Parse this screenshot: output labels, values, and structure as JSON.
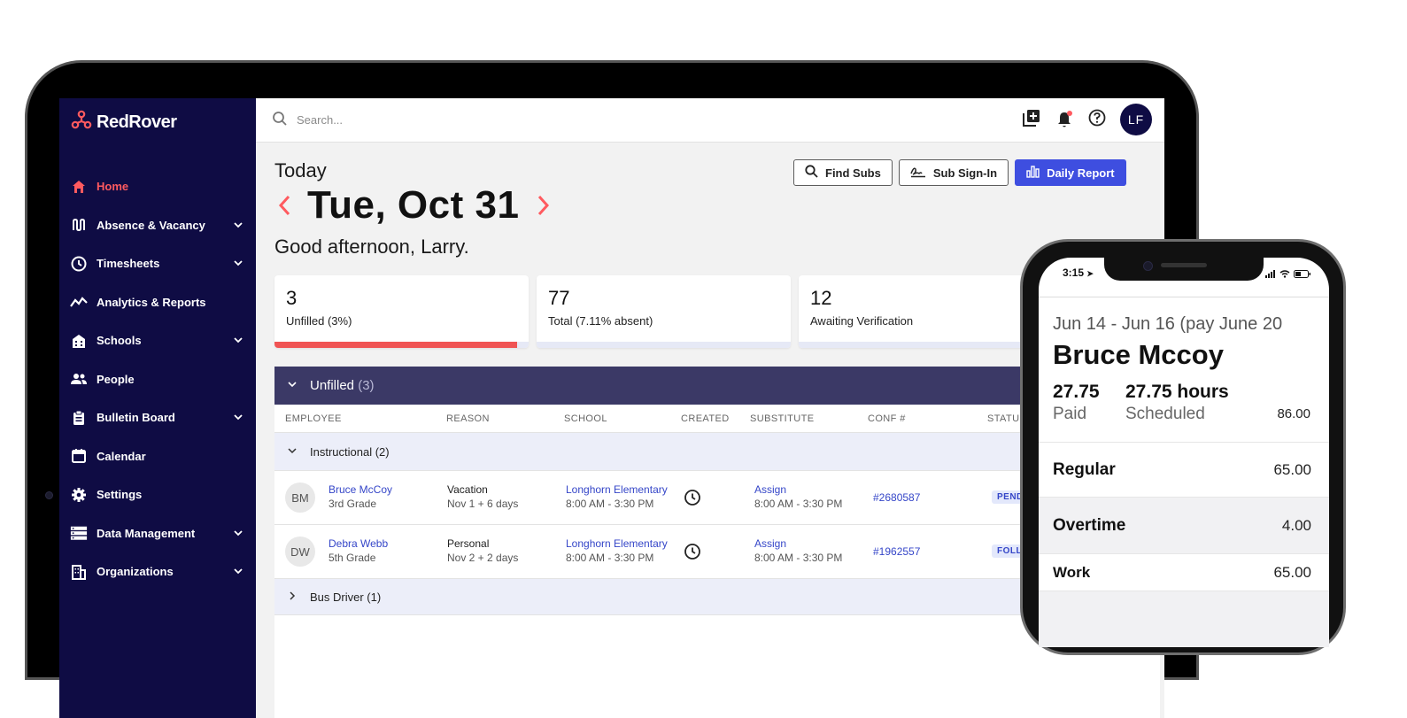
{
  "app": {
    "brand": "RedRover",
    "search_placeholder": "Search...",
    "user_initials": "LF"
  },
  "sidebar": {
    "items": [
      {
        "label": "Home",
        "icon": "home-icon",
        "active": true,
        "expandable": false
      },
      {
        "label": "Absence & Vacancy",
        "icon": "route-icon",
        "active": false,
        "expandable": true
      },
      {
        "label": "Timesheets",
        "icon": "clock-icon",
        "active": false,
        "expandable": true
      },
      {
        "label": "Analytics & Reports",
        "icon": "trend-line-icon",
        "active": false,
        "expandable": false
      },
      {
        "label": "Schools",
        "icon": "building-icon",
        "active": false,
        "expandable": true
      },
      {
        "label": "People",
        "icon": "people-icon",
        "active": false,
        "expandable": false
      },
      {
        "label": "Bulletin Board",
        "icon": "clipboard-icon",
        "active": false,
        "expandable": true
      },
      {
        "label": "Calendar",
        "icon": "calendar-icon",
        "active": false,
        "expandable": false
      },
      {
        "label": "Settings",
        "icon": "gear-icon",
        "active": false,
        "expandable": false
      },
      {
        "label": "Data Management",
        "icon": "server-icon",
        "active": false,
        "expandable": true
      },
      {
        "label": "Organizations",
        "icon": "office-building-icon",
        "active": false,
        "expandable": true
      }
    ]
  },
  "header": {
    "today_label": "Today",
    "date": "Tue, Oct 31",
    "greeting": "Good afternoon, Larry."
  },
  "actions": {
    "find_subs": "Find Subs",
    "sub_sign_in": "Sub Sign-In",
    "daily_report": "Daily Report"
  },
  "stats": [
    {
      "value": "3",
      "caption": "Unfilled (3%)",
      "bar_fraction": 0.955
    },
    {
      "value": "77",
      "caption": "Total (7.11% absent)",
      "bar_fraction": 0
    },
    {
      "value": "12",
      "caption": "Awaiting Verification",
      "bar_fraction": 0
    }
  ],
  "panel": {
    "title": "Unfilled",
    "count": "(3)",
    "columns": [
      "EMPLOYEE",
      "REASON",
      "SCHOOL",
      "CREATED",
      "SUBSTITUTE",
      "CONF #",
      "STATUS"
    ],
    "groups": [
      {
        "label": "Instructional (2)",
        "expanded": true
      },
      {
        "label": "Bus Driver (1)",
        "expanded": false
      }
    ],
    "rows": [
      {
        "initials": "BM",
        "name": "Bruce McCoy",
        "grade": "3rd Grade",
        "reason": "Vacation",
        "reason_detail": "Nov 1 + 6 days",
        "school": "Longhorn Elementary",
        "school_time": "8:00 AM - 3:30 PM",
        "substitute": "Assign",
        "sub_time": "8:00 AM - 3:30 PM",
        "conf": "#2680587",
        "status": "PEND"
      },
      {
        "initials": "DW",
        "name": "Debra Webb",
        "grade": "5th Grade",
        "reason": "Personal",
        "reason_detail": "Nov 2 + 2 days",
        "school": "Longhorn Elementary",
        "school_time": "8:00 AM - 3:30 PM",
        "substitute": "Assign",
        "sub_time": "8:00 AM - 3:30 PM",
        "conf": "#1962557",
        "status": "FOLL"
      }
    ]
  },
  "phone": {
    "time": "3:15",
    "range": "Jun 14 - Jun 16 (pay June 20",
    "name": "Bruce Mccoy",
    "paid_value": "27.75",
    "paid_label": "Paid",
    "scheduled_value": "27.75 hours",
    "scheduled_label": "Scheduled",
    "extra_value": "86.00",
    "rows": [
      {
        "label": "Regular",
        "value": "65.00"
      },
      {
        "label": "Overtime",
        "value": "4.00"
      },
      {
        "label": "Work",
        "value": "65.00"
      }
    ]
  },
  "colors": {
    "sidebar_bg": "#0f0c44",
    "accent_red": "#ff5a5f",
    "primary_blue": "#3e4ee0",
    "panel_header": "#3b3966"
  }
}
